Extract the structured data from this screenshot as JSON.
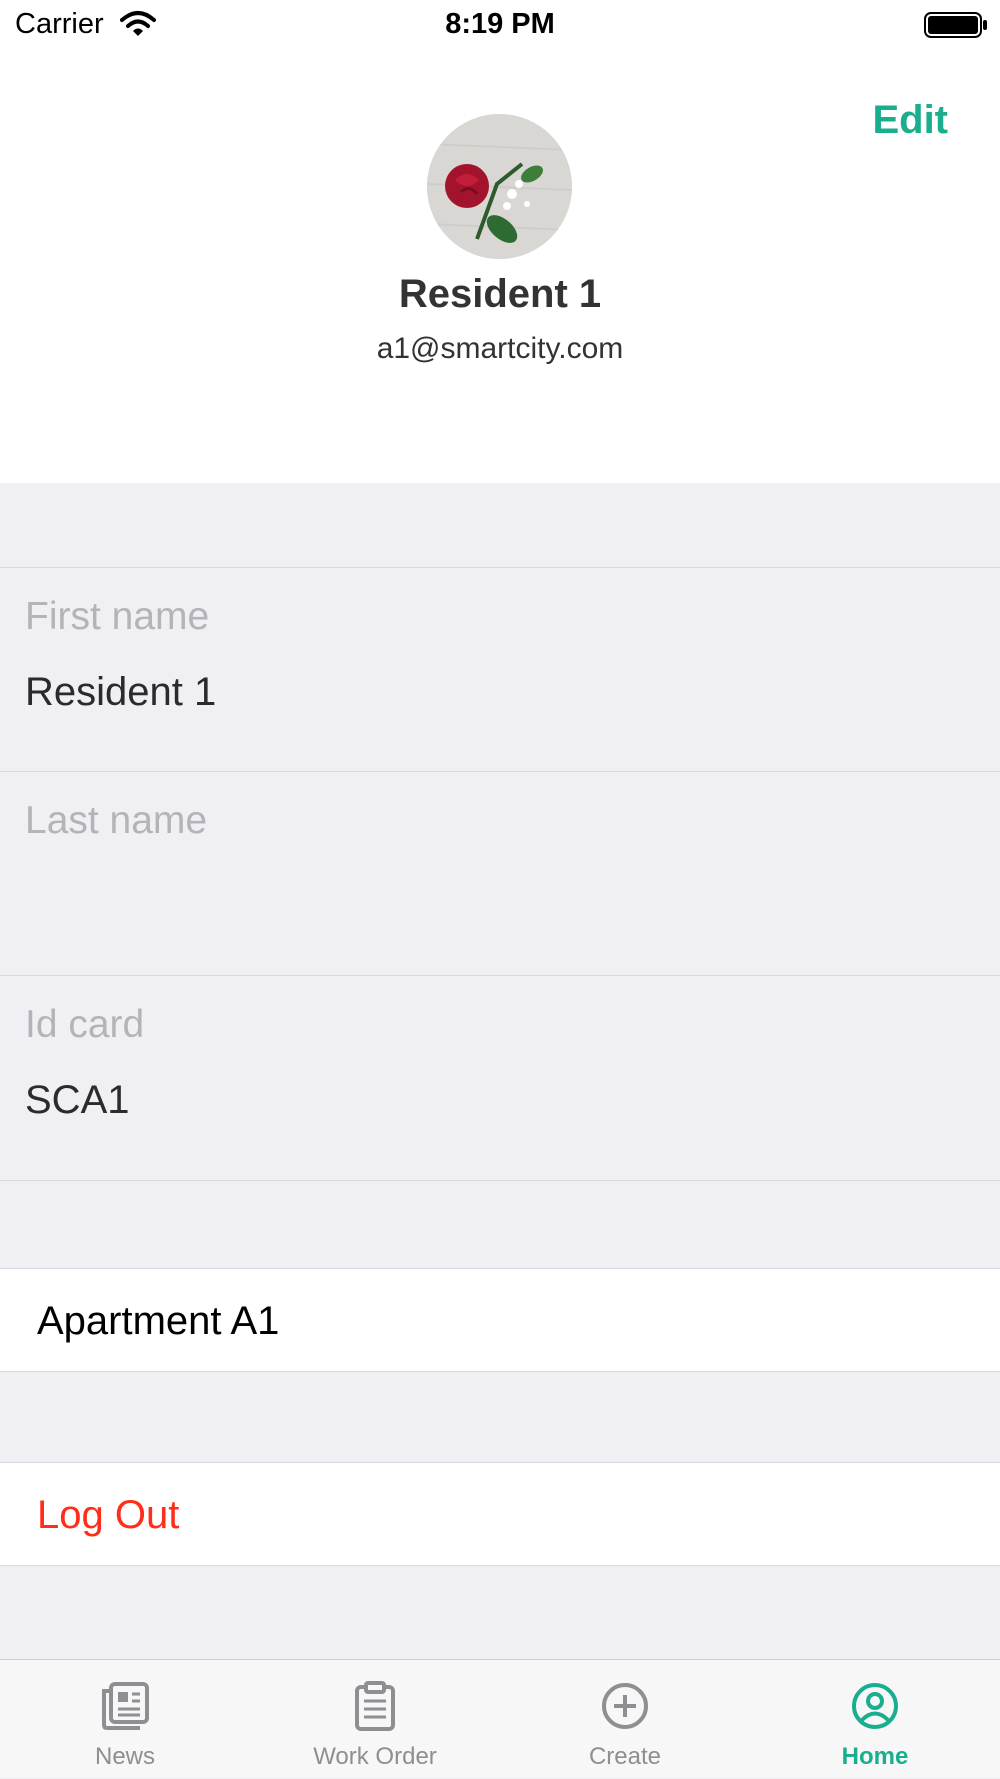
{
  "status_bar": {
    "carrier": "Carrier",
    "time": "8:19 PM"
  },
  "header": {
    "edit_label": "Edit",
    "name": "Resident 1",
    "email": "a1@smartcity.com"
  },
  "fields": [
    {
      "label": "First name",
      "value": "Resident 1"
    },
    {
      "label": "Last name",
      "value": ""
    },
    {
      "label": "Id card",
      "value": "SCA1"
    }
  ],
  "apartment": {
    "label": "Apartment A1"
  },
  "logout": {
    "label": "Log Out"
  },
  "tabs": [
    {
      "label": "News",
      "icon": "news-icon"
    },
    {
      "label": "Work Order",
      "icon": "clipboard-icon"
    },
    {
      "label": "Create",
      "icon": "plus-circle-icon"
    },
    {
      "label": "Home",
      "icon": "user-circle-icon",
      "active": true
    }
  ],
  "colors": {
    "accent": "#1aae8e",
    "destructive": "#ff2d1a",
    "background": "#efeff4",
    "tab_inactive": "#8e8e93"
  }
}
